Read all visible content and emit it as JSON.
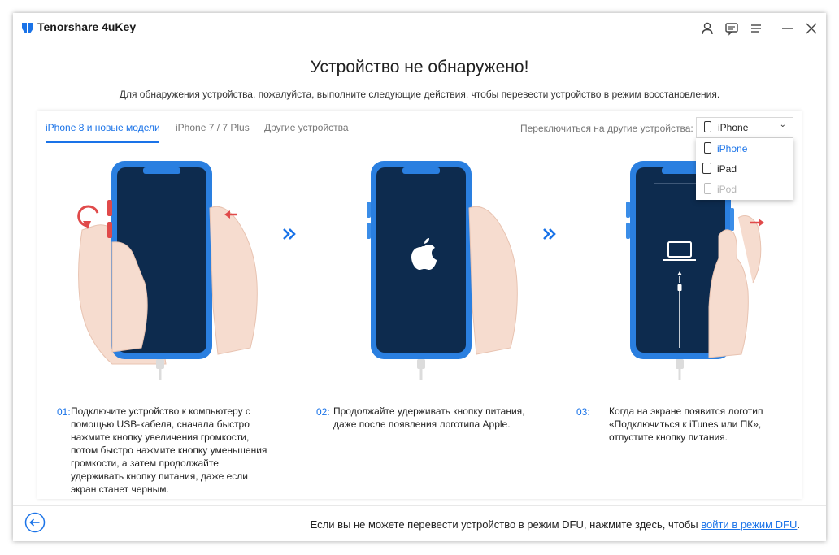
{
  "app": {
    "title": "Tenorshare 4uKey"
  },
  "titlebar": {
    "icons": [
      "user-icon",
      "feedback-icon",
      "menu-icon",
      "minimize-icon",
      "close-icon"
    ]
  },
  "main": {
    "title": "Устройство не обнаружено!",
    "subtitle": "Для обнаружения устройства, пожалуйста, выполните следующие действия, чтобы перевести устройство в режим восстановления."
  },
  "tabs": [
    {
      "label": "iPhone 8 и новые модели",
      "active": true
    },
    {
      "label": "iPhone 7 / 7 Plus",
      "active": false
    },
    {
      "label": "Другие устройства",
      "active": false
    }
  ],
  "device_switch": {
    "label": "Переключиться на другие устройства:",
    "selected": "iPhone",
    "options": [
      {
        "label": "iPhone",
        "state": "selected"
      },
      {
        "label": "iPad",
        "state": "normal"
      },
      {
        "label": "iPod",
        "state": "disabled"
      }
    ]
  },
  "steps": [
    {
      "num": "01:",
      "text": "Подключите устройство к компьютеру с помощью USB-кабеля, сначала быстро нажмите кнопку увеличения громкости, потом быстро нажмите кнопку уменьшения громкости, а затем продолжайте удерживать кнопку питания, даже если экран станет черным."
    },
    {
      "num": "02:",
      "text": "Продолжайте удерживать кнопку питания, даже после появления логотипа Apple."
    },
    {
      "num": "03:",
      "text": "Когда на экране появится логотип «Подключиться к iTunes или ПК», отпустите кнопку питания."
    }
  ],
  "footer": {
    "text": "Если вы не можете перевести устройство в режим DFU, нажмите здесь, чтобы ",
    "link": "войти в режим DFU",
    "suffix": "."
  },
  "colors": {
    "accent": "#1a73e8",
    "phone_body": "#2a7fe0",
    "phone_screen": "#0d2b4e",
    "button_red": "#e04a4a",
    "hand": "#f6dccf"
  }
}
